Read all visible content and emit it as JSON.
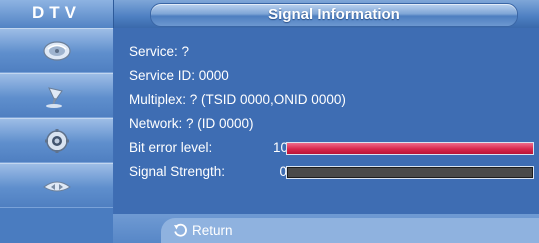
{
  "header": {
    "mode_label": "DTV",
    "title": "Signal Information"
  },
  "sidebar": {
    "items": [
      {
        "icon": "satellite-dish-icon"
      },
      {
        "icon": "antenna-icon"
      },
      {
        "icon": "gear-icon"
      },
      {
        "icon": "remote-arrows-icon"
      }
    ]
  },
  "info": {
    "service": "Service: ?",
    "service_id": "Service ID: 0000",
    "multiplex": "Multiplex: ? (TSID 0000,ONID 0000)",
    "network": "Network: ? (ID 0000)",
    "bit_error": {
      "label": "Bit error level:",
      "value": "10",
      "level_fraction": 1.0
    },
    "signal_strength": {
      "label": "Signal Strength:",
      "value": "0",
      "level_fraction": 0.0
    }
  },
  "footer": {
    "return_label": "Return"
  },
  "colors": {
    "background": "#3e6db3",
    "bar_fill": "#d8274d",
    "bar_empty": "#4a4a4a"
  }
}
